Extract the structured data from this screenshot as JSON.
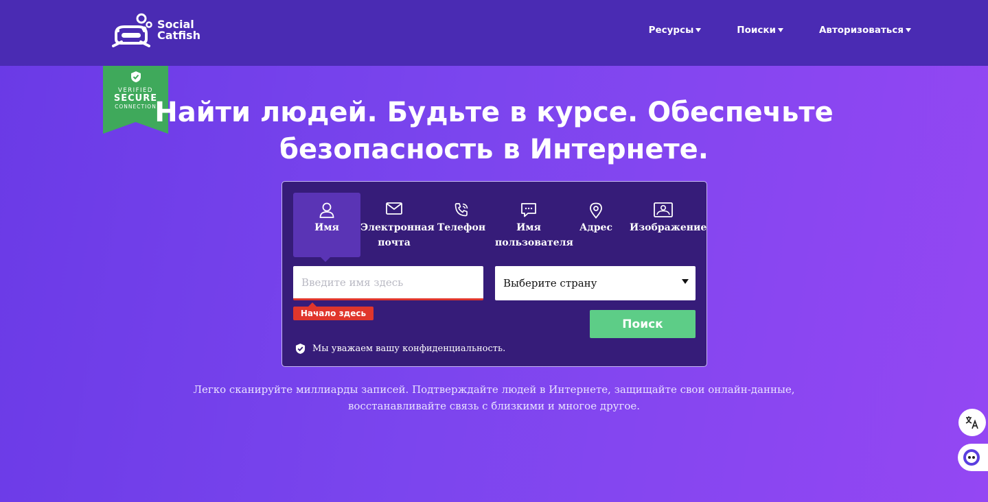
{
  "brand": {
    "line1": "Social",
    "line2": "Catfish"
  },
  "nav": [
    {
      "label": "Ресурсы"
    },
    {
      "label": "Поиски"
    },
    {
      "label": "Авторизоваться"
    }
  ],
  "badge": {
    "line1": "VERIFIED",
    "line2": "SECURE",
    "line3": "CONNECTION"
  },
  "headline": {
    "line1": "Найти людей. Будьте в курсе. Обеспечьте",
    "line2": "безопасность в Интернете."
  },
  "search": {
    "tabs": [
      {
        "line1": "Имя",
        "line2": "",
        "icon": "person-icon"
      },
      {
        "line1": "Электронная",
        "line2": "почта",
        "icon": "envelope-icon"
      },
      {
        "line1": "Телефон",
        "line2": "",
        "icon": "phone-icon"
      },
      {
        "line1": "Имя",
        "line2": "пользователя",
        "icon": "chat-icon"
      },
      {
        "line1": "Адрес",
        "line2": "",
        "icon": "map-pin-icon"
      },
      {
        "line1": "Изображение",
        "line2": "",
        "icon": "image-icon"
      }
    ],
    "active_tab": "Имя",
    "name_placeholder": "Введите имя здесь",
    "name_value": "",
    "hint": "Начало здесь",
    "country_selected": "Выберите страну",
    "button": "Поиск",
    "privacy": "Мы уважаем вашу конфиденциальность."
  },
  "description": {
    "line1": "Легко сканируйте миллиарды записей. Подтверждайте людей в Интернете, защищайте свои онлайн-данные,",
    "line2": "восстанавливайте связь с близкими и многое другое."
  },
  "colors": {
    "header": "#4a2bb3",
    "card": "#361c79",
    "accent_red": "#e0362c",
    "button_green": "#5dcd87",
    "badge_green": "#3fa95b"
  }
}
